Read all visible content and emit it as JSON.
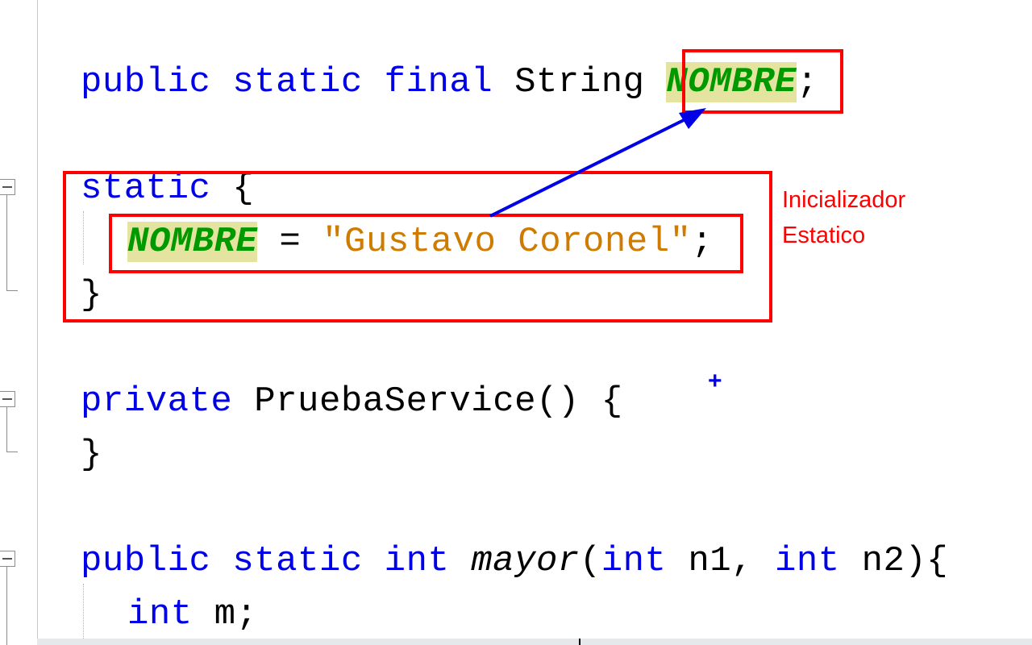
{
  "editor": {
    "lines": {
      "l1": {
        "kw": "public static final",
        "type": " String ",
        "const": "NOMBRE",
        "end": ";"
      },
      "l2": {
        "kw": "static",
        "rest": " {"
      },
      "l3": {
        "const": "NOMBRE",
        "mid": " = ",
        "str": "\"Gustavo Coronel\"",
        "end": ";"
      },
      "l4": {
        "text": "}"
      },
      "l5": {
        "kw": "private",
        "rest": " PruebaService() {"
      },
      "l6": {
        "text": "}"
      },
      "l7": {
        "kw1": "public static int",
        "method": "mayor",
        "p1": "(",
        "kw2": "int",
        "p2": " n1, ",
        "kw3": "int",
        "p3": " n2){"
      },
      "l8": {
        "kw": "int",
        "rest": " m;"
      }
    }
  },
  "annotation": {
    "label_line1": "Inicializador",
    "label_line2": "Estatico",
    "plus": "+",
    "box_color": "#ff0000",
    "arrow_color": "#0000e6"
  }
}
